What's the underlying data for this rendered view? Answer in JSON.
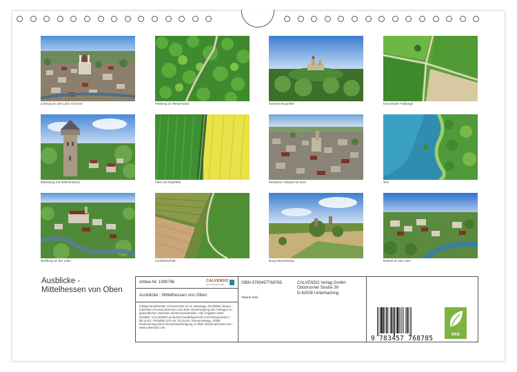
{
  "product": {
    "title_line1": "Ausblicke -",
    "title_line2": "Mittelhessen von Oben"
  },
  "photos": [
    {
      "caption": "Limburg an der Lahn mit Dom"
    },
    {
      "caption": "Feldweg im Westerwald"
    },
    {
      "caption": "Schloss Braunfels"
    },
    {
      "caption": "Kreuzende Feldwege"
    },
    {
      "caption": "Dillenburg mit Wilhelmsturm"
    },
    {
      "caption": "Allee mit Rapsfeld"
    },
    {
      "caption": "Wetzlarer Altstadt mit Dom"
    },
    {
      "caption": "See"
    },
    {
      "caption": "Weilburg an der Lahn"
    },
    {
      "caption": "Landwirtschaft"
    },
    {
      "caption": "Burg Münzenberg"
    },
    {
      "caption": "Runkel an der Lahn"
    }
  ],
  "info": {
    "article": "Artikel-Nr. 1990796",
    "logo": "CALVENDO",
    "logo_sub": "Der Kalenderverlag",
    "series_title": "Ausblicke - Mittelhessen von Oben",
    "legal_text": "Infolge bestehender Schutzrechte ist es untersagt, die Blätter dieses Kalenders herauszutrennen und ohne Genehmigung des Verlages zu gewerblichen Zwecken weiterzuverwenden. Alle Angaben ohne Gewähr. CALVENDO produziert bedarfsgerecht und klimaneutral in DE & EU. Preisliste (CG-Nr. 01) kurze Transportwege. Abfall-Reduzierung durch Einzelstückfertigung. E-Mail: info@calvendo.com - www.calvendo.com",
    "isbn": "ISBN 9783457768785",
    "format": "Tasche Stck",
    "publisher_line1": "CALVENDO Verlag GmbH",
    "publisher_line2": "Ottobrunner Straße 39",
    "publisher_line3": "D-82008 Unterhaching",
    "barcode_number": "9  783457  768785",
    "eco_label": "eco"
  }
}
